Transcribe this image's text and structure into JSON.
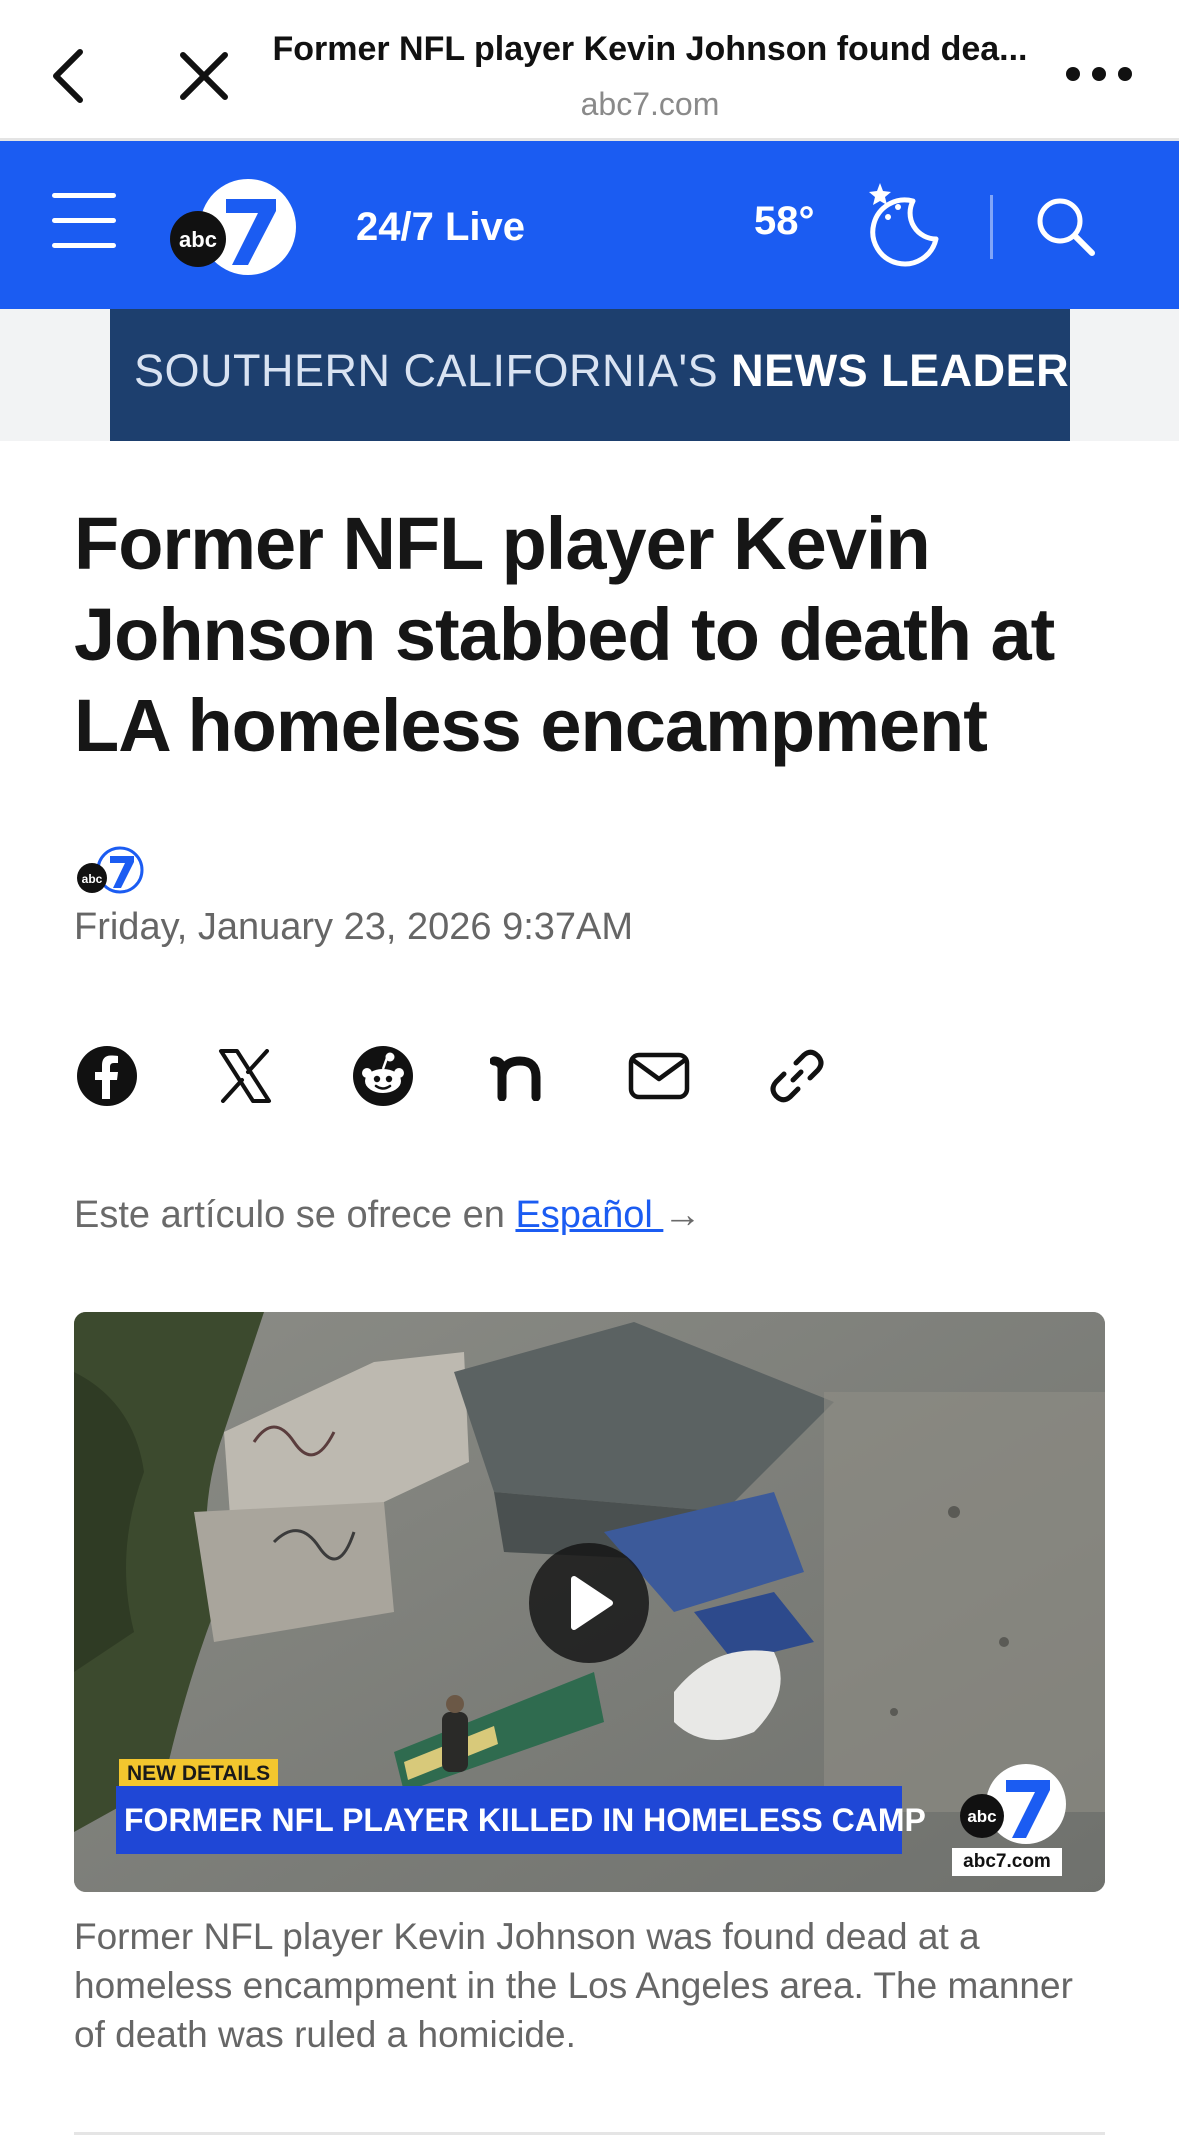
{
  "browser": {
    "title": "Former NFL player Kevin Johnson found dea...",
    "domain": "abc7.com",
    "back_icon": "chevron-left-icon",
    "close_icon": "close-icon",
    "more_icon": "more-dots-icon"
  },
  "site_header": {
    "menu_icon": "hamburger-menu-icon",
    "logo_text": "abc",
    "live_label": "24/7 Live",
    "temperature": "58°",
    "weather_icon": "moon-stars-icon",
    "search_icon": "search-icon",
    "background_color": "#1b5cf2"
  },
  "banner": {
    "text_regular": "SOUTHERN CALIFORNIA'S ",
    "text_bold": "NEWS LEADER"
  },
  "article": {
    "headline": "Former NFL player Kevin Johnson stabbed to death at LA homeless encampment",
    "date": "Friday, January 23, 2026 9:37AM",
    "share_icons": [
      "facebook-icon",
      "x-icon",
      "reddit-icon",
      "nextdoor-icon",
      "email-icon",
      "link-icon"
    ],
    "language_prefix": "Este artículo se ofrece en ",
    "language_link": "Español ",
    "language_arrow": "→"
  },
  "video": {
    "play_icon": "play-icon",
    "tag": "NEW DETAILS",
    "lower_third": "FORMER NFL PLAYER KILLED IN HOMELESS CAMP",
    "watermark_logo": "abc",
    "watermark_site": "abc7.com"
  },
  "caption": "Former NFL player Kevin Johnson was found dead at a homeless encampment in the Los Angeles area. The manner of death was ruled a homicide."
}
